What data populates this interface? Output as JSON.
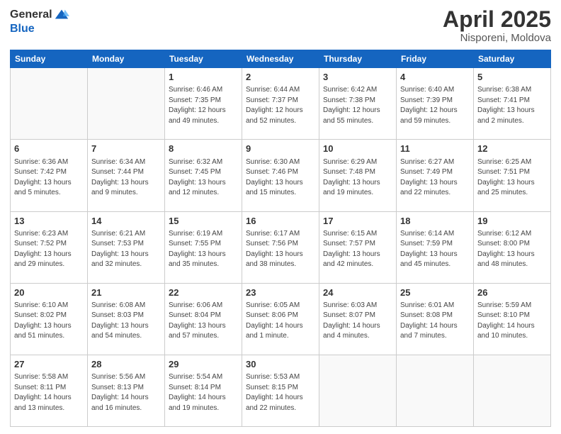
{
  "header": {
    "logo_general": "General",
    "logo_blue": "Blue",
    "title": "April 2025",
    "location": "Nisporeni, Moldova"
  },
  "days_of_week": [
    "Sunday",
    "Monday",
    "Tuesday",
    "Wednesday",
    "Thursday",
    "Friday",
    "Saturday"
  ],
  "weeks": [
    [
      {
        "day": "",
        "info": ""
      },
      {
        "day": "",
        "info": ""
      },
      {
        "day": "1",
        "info": "Sunrise: 6:46 AM\nSunset: 7:35 PM\nDaylight: 12 hours and 49 minutes."
      },
      {
        "day": "2",
        "info": "Sunrise: 6:44 AM\nSunset: 7:37 PM\nDaylight: 12 hours and 52 minutes."
      },
      {
        "day": "3",
        "info": "Sunrise: 6:42 AM\nSunset: 7:38 PM\nDaylight: 12 hours and 55 minutes."
      },
      {
        "day": "4",
        "info": "Sunrise: 6:40 AM\nSunset: 7:39 PM\nDaylight: 12 hours and 59 minutes."
      },
      {
        "day": "5",
        "info": "Sunrise: 6:38 AM\nSunset: 7:41 PM\nDaylight: 13 hours and 2 minutes."
      }
    ],
    [
      {
        "day": "6",
        "info": "Sunrise: 6:36 AM\nSunset: 7:42 PM\nDaylight: 13 hours and 5 minutes."
      },
      {
        "day": "7",
        "info": "Sunrise: 6:34 AM\nSunset: 7:44 PM\nDaylight: 13 hours and 9 minutes."
      },
      {
        "day": "8",
        "info": "Sunrise: 6:32 AM\nSunset: 7:45 PM\nDaylight: 13 hours and 12 minutes."
      },
      {
        "day": "9",
        "info": "Sunrise: 6:30 AM\nSunset: 7:46 PM\nDaylight: 13 hours and 15 minutes."
      },
      {
        "day": "10",
        "info": "Sunrise: 6:29 AM\nSunset: 7:48 PM\nDaylight: 13 hours and 19 minutes."
      },
      {
        "day": "11",
        "info": "Sunrise: 6:27 AM\nSunset: 7:49 PM\nDaylight: 13 hours and 22 minutes."
      },
      {
        "day": "12",
        "info": "Sunrise: 6:25 AM\nSunset: 7:51 PM\nDaylight: 13 hours and 25 minutes."
      }
    ],
    [
      {
        "day": "13",
        "info": "Sunrise: 6:23 AM\nSunset: 7:52 PM\nDaylight: 13 hours and 29 minutes."
      },
      {
        "day": "14",
        "info": "Sunrise: 6:21 AM\nSunset: 7:53 PM\nDaylight: 13 hours and 32 minutes."
      },
      {
        "day": "15",
        "info": "Sunrise: 6:19 AM\nSunset: 7:55 PM\nDaylight: 13 hours and 35 minutes."
      },
      {
        "day": "16",
        "info": "Sunrise: 6:17 AM\nSunset: 7:56 PM\nDaylight: 13 hours and 38 minutes."
      },
      {
        "day": "17",
        "info": "Sunrise: 6:15 AM\nSunset: 7:57 PM\nDaylight: 13 hours and 42 minutes."
      },
      {
        "day": "18",
        "info": "Sunrise: 6:14 AM\nSunset: 7:59 PM\nDaylight: 13 hours and 45 minutes."
      },
      {
        "day": "19",
        "info": "Sunrise: 6:12 AM\nSunset: 8:00 PM\nDaylight: 13 hours and 48 minutes."
      }
    ],
    [
      {
        "day": "20",
        "info": "Sunrise: 6:10 AM\nSunset: 8:02 PM\nDaylight: 13 hours and 51 minutes."
      },
      {
        "day": "21",
        "info": "Sunrise: 6:08 AM\nSunset: 8:03 PM\nDaylight: 13 hours and 54 minutes."
      },
      {
        "day": "22",
        "info": "Sunrise: 6:06 AM\nSunset: 8:04 PM\nDaylight: 13 hours and 57 minutes."
      },
      {
        "day": "23",
        "info": "Sunrise: 6:05 AM\nSunset: 8:06 PM\nDaylight: 14 hours and 1 minute."
      },
      {
        "day": "24",
        "info": "Sunrise: 6:03 AM\nSunset: 8:07 PM\nDaylight: 14 hours and 4 minutes."
      },
      {
        "day": "25",
        "info": "Sunrise: 6:01 AM\nSunset: 8:08 PM\nDaylight: 14 hours and 7 minutes."
      },
      {
        "day": "26",
        "info": "Sunrise: 5:59 AM\nSunset: 8:10 PM\nDaylight: 14 hours and 10 minutes."
      }
    ],
    [
      {
        "day": "27",
        "info": "Sunrise: 5:58 AM\nSunset: 8:11 PM\nDaylight: 14 hours and 13 minutes."
      },
      {
        "day": "28",
        "info": "Sunrise: 5:56 AM\nSunset: 8:13 PM\nDaylight: 14 hours and 16 minutes."
      },
      {
        "day": "29",
        "info": "Sunrise: 5:54 AM\nSunset: 8:14 PM\nDaylight: 14 hours and 19 minutes."
      },
      {
        "day": "30",
        "info": "Sunrise: 5:53 AM\nSunset: 8:15 PM\nDaylight: 14 hours and 22 minutes."
      },
      {
        "day": "",
        "info": ""
      },
      {
        "day": "",
        "info": ""
      },
      {
        "day": "",
        "info": ""
      }
    ]
  ]
}
